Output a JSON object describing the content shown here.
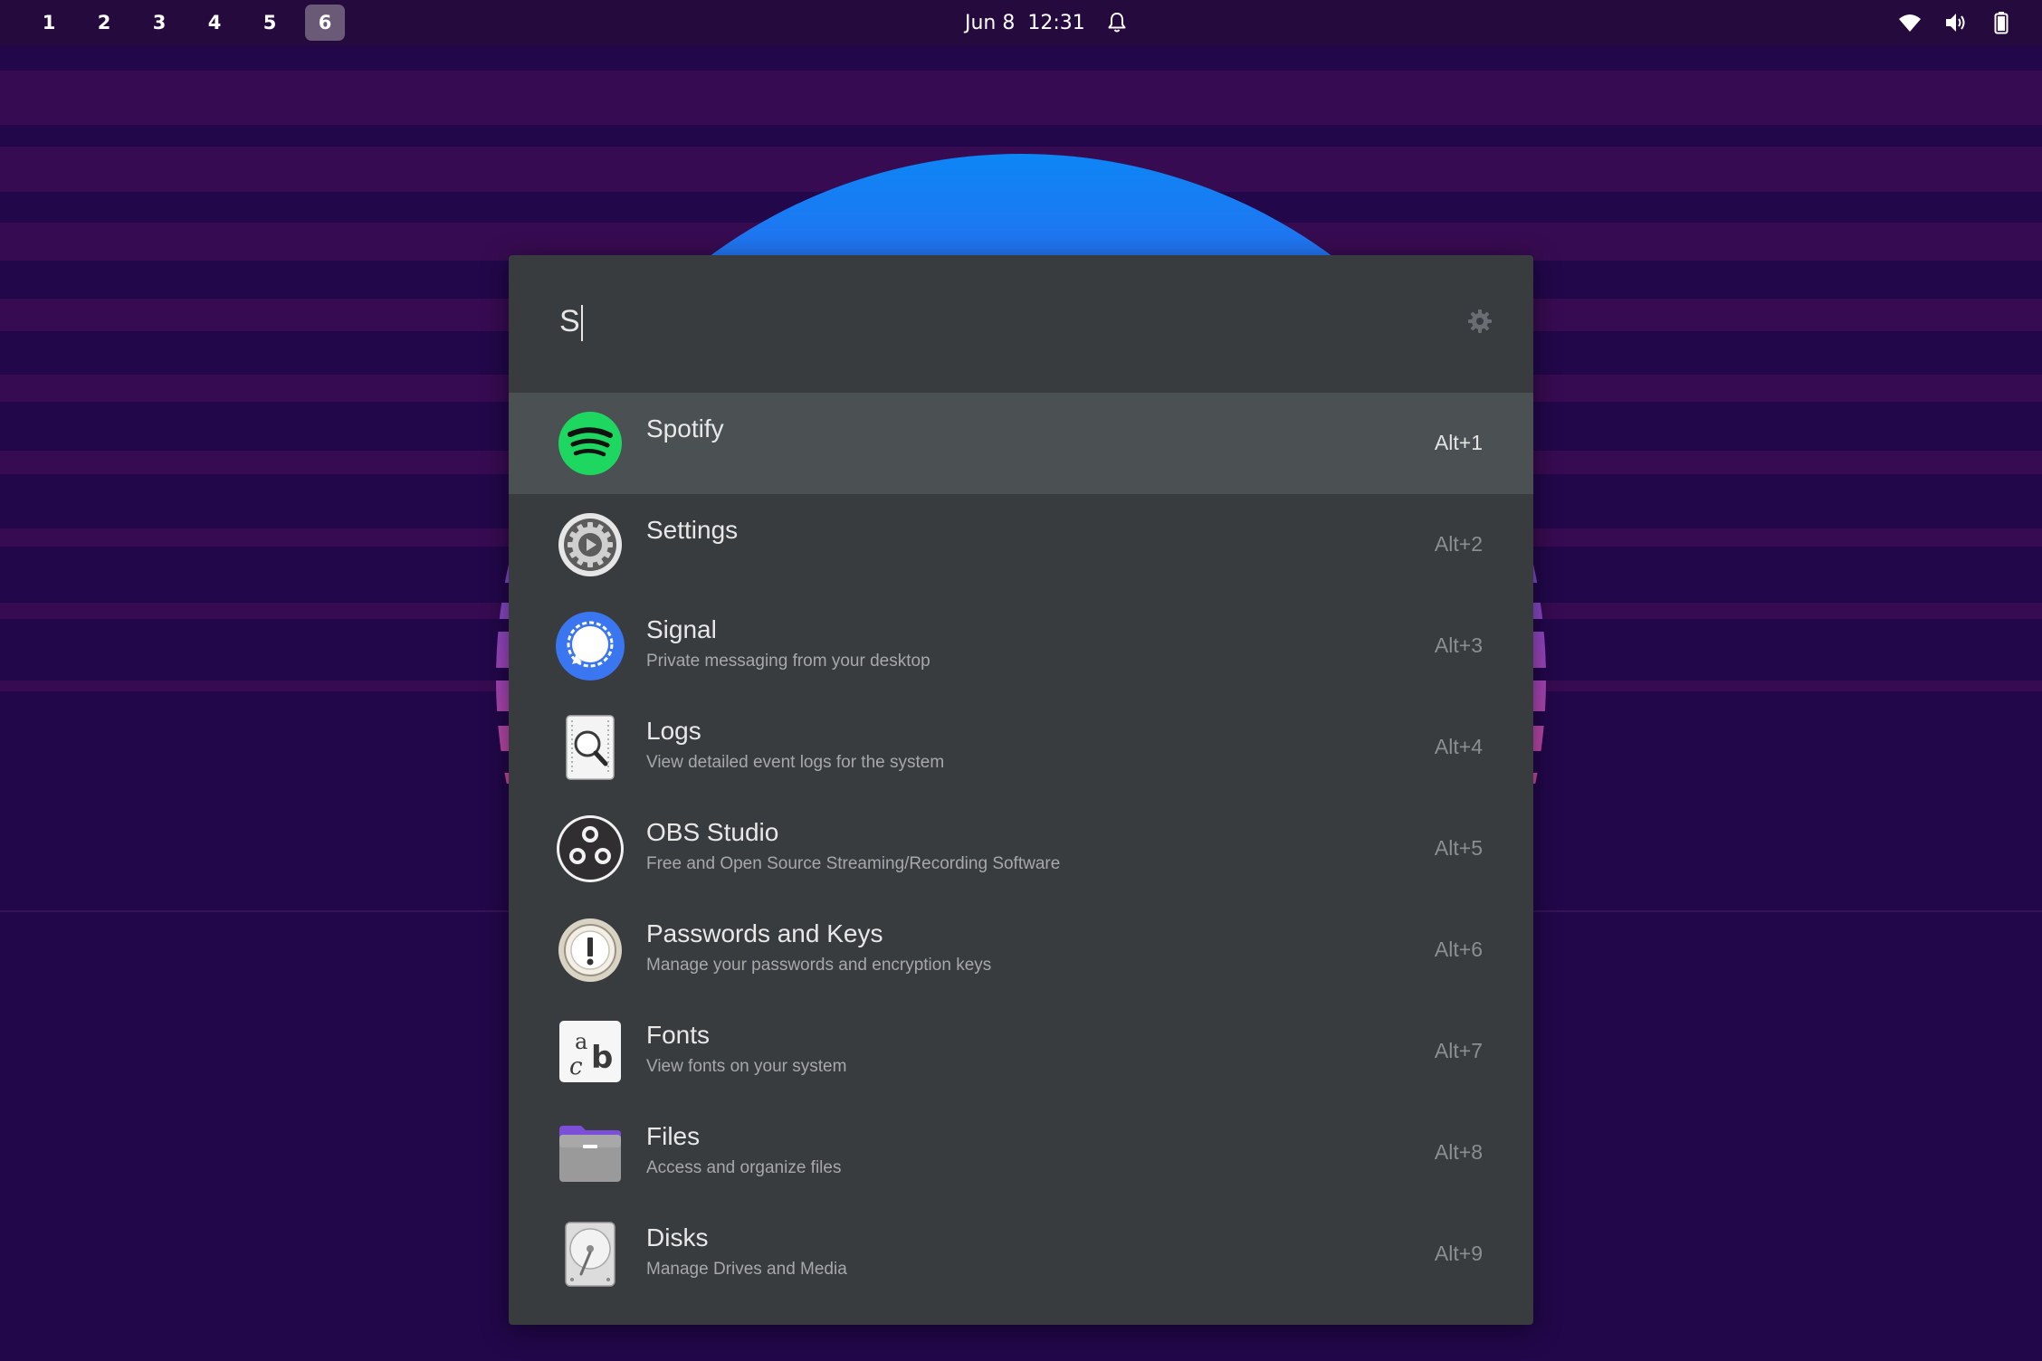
{
  "topbar": {
    "workspaces": [
      {
        "label": "1"
      },
      {
        "label": "2"
      },
      {
        "label": "3"
      },
      {
        "label": "4"
      },
      {
        "label": "5"
      },
      {
        "label": "6",
        "active": true
      }
    ],
    "clock": "Jun 8  12:31",
    "icons": [
      "bell-icon",
      "wifi-icon",
      "volume-icon",
      "battery-icon"
    ]
  },
  "launcher": {
    "query": "S",
    "prefs_icon": "gear-icon",
    "results": [
      {
        "name": "Spotify",
        "description": "",
        "shortcut": "Alt+1",
        "icon": "spotify-icon",
        "selected": true
      },
      {
        "name": "Settings",
        "description": "",
        "shortcut": "Alt+2",
        "icon": "settings-icon"
      },
      {
        "name": "Signal",
        "description": "Private messaging from your desktop",
        "shortcut": "Alt+3",
        "icon": "signal-icon"
      },
      {
        "name": "Logs",
        "description": "View detailed event logs for the system",
        "shortcut": "Alt+4",
        "icon": "logs-icon"
      },
      {
        "name": "OBS Studio",
        "description": "Free and Open Source Streaming/Recording Software",
        "shortcut": "Alt+5",
        "icon": "obs-icon"
      },
      {
        "name": "Passwords and Keys",
        "description": "Manage your passwords and encryption keys",
        "shortcut": "Alt+6",
        "icon": "passwords-icon"
      },
      {
        "name": "Fonts",
        "description": "View fonts on your system",
        "shortcut": "Alt+7",
        "icon": "fonts-icon"
      },
      {
        "name": "Files",
        "description": "Access and organize files",
        "shortcut": "Alt+8",
        "icon": "files-icon"
      },
      {
        "name": "Disks",
        "description": "Manage Drives and Media",
        "shortcut": "Alt+9",
        "icon": "disks-icon"
      }
    ]
  },
  "colors": {
    "panel": "#393c3f",
    "selected_row": "#4b5053",
    "topbar": "#250a3e",
    "wallpaper_stripe": "#370b51",
    "sun_top": "#0d86f5",
    "sun_bottom": "#f26b4a"
  }
}
